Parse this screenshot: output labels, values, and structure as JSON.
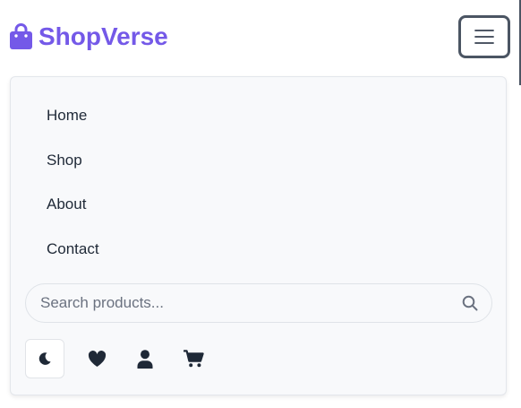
{
  "brand": {
    "name": "ShopVerse",
    "icon": "shopping-bag-icon",
    "color": "#7459e8"
  },
  "header": {
    "menu_toggle_icon": "hamburger-menu-icon"
  },
  "nav": {
    "items": [
      {
        "label": "Home"
      },
      {
        "label": "Shop"
      },
      {
        "label": "About"
      },
      {
        "label": "Contact"
      }
    ]
  },
  "search": {
    "placeholder": "Search products...",
    "value": "",
    "icon": "search-icon"
  },
  "actions": {
    "theme_icon": "moon-icon",
    "wishlist_icon": "heart-icon",
    "account_icon": "user-icon",
    "cart_icon": "cart-icon"
  },
  "colors": {
    "text": "#1f2937",
    "panel_background": "#f8f9fb",
    "toggle_border": "#4b5563"
  }
}
